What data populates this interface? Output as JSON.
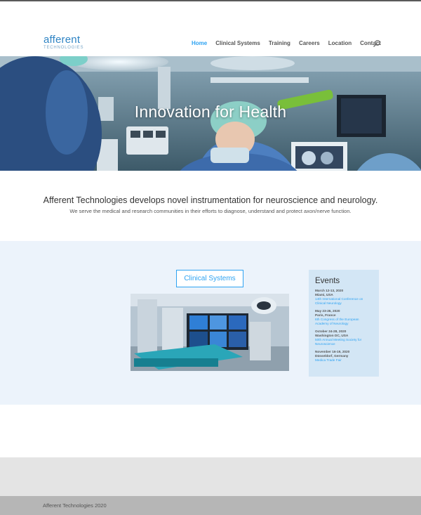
{
  "brand": {
    "name": "afferent",
    "tagline": "TECHNOLOGIES"
  },
  "nav": {
    "items": [
      {
        "label": "Home",
        "active": true
      },
      {
        "label": "Clinical Systems",
        "active": false
      },
      {
        "label": "Training",
        "active": false
      },
      {
        "label": "Careers",
        "active": false
      },
      {
        "label": "Location",
        "active": false
      },
      {
        "label": "Contact",
        "active": false
      }
    ],
    "search_icon": "search-icon"
  },
  "hero": {
    "title": "Innovation for Health"
  },
  "intro": {
    "title": "Afferent Technologies develops novel instrumentation for neuroscience and neurology.",
    "subtitle": "We serve the medical and research communities in their efforts to diagnose, understand and protect axon/nerve function."
  },
  "clinical": {
    "button_label": "Clinical Systems"
  },
  "events": {
    "title": "Events",
    "items": [
      {
        "date": "March 12-13, 2020",
        "place": "Miami, USA",
        "name": "14th International Conference on Clinical Neurology"
      },
      {
        "date": "May 23-26, 2020",
        "place": "Paris, France",
        "name": "6th Congress of the European Academy of Neurology"
      },
      {
        "date": "October 24-28, 2020",
        "place": "Washington DC, USA",
        "name": "50th Annual Meeting Society for Neuroscience"
      },
      {
        "date": "November 16-19, 2020",
        "place": "Düsseldorf, Germany",
        "name": "Medica Trade Fair"
      }
    ]
  },
  "footer": {
    "copyright": "Afferent Technologies 2020"
  },
  "colors": {
    "accent": "#2ea3f2",
    "section_bg": "#ecf3fb",
    "events_bg": "#d3e6f5",
    "footer_top": "#e4e4e4",
    "footer_bottom": "#b6b6b6"
  }
}
